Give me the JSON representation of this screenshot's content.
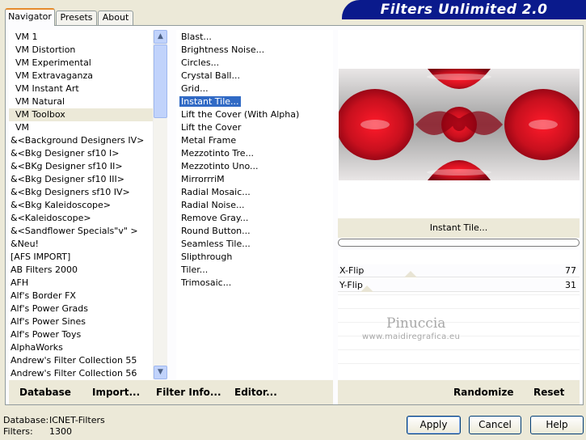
{
  "tabs": [
    {
      "label": "Navigator",
      "active": true
    },
    {
      "label": "Presets",
      "active": false
    },
    {
      "label": "About",
      "active": false
    }
  ],
  "banner_title": "Filters Unlimited 2.0",
  "categories": [
    "VM 1",
    "VM Distortion",
    "VM Experimental",
    "VM Extravaganza",
    "VM Instant Art",
    "VM Natural",
    "VM Toolbox",
    "VM",
    "&<Background Designers IV>",
    "&<Bkg Designer sf10 I>",
    "&<BKg Designer sf10 II>",
    "&<Bkg Designer sf10 III>",
    "&<Bkg Designers sf10 IV>",
    "&<Bkg Kaleidoscope>",
    "&<Kaleidoscope>",
    "&<Sandflower Specials\"v\" >",
    "&Neu!",
    "[AFS IMPORT]",
    "AB Filters 2000",
    "AFH",
    "Alf's Border FX",
    "Alf's Power Grads",
    "Alf's Power Sines",
    "Alf's Power Toys",
    "AlphaWorks",
    "Andrew's Filter Collection 55",
    "Andrew's Filter Collection 56"
  ],
  "selected_category": "VM Toolbox",
  "filters": [
    "Blast...",
    "Brightness Noise...",
    "Circles...",
    "Crystal Ball...",
    "Grid...",
    "Instant Tile...",
    "Lift the Cover (With Alpha)",
    "Lift the Cover",
    "Metal Frame",
    "Mezzotinto Tre...",
    "Mezzotinto Uno...",
    "MirrorrriM",
    "Radial Mosaic...",
    "Radial Noise...",
    "Remove Gray...",
    "Round Button...",
    "Seamless Tile...",
    "Slipthrough",
    "Tiler...",
    "Trimosaic..."
  ],
  "selected_filter": "Instant Tile...",
  "filter_name": "Instant Tile...",
  "params": [
    {
      "label": "X-Flip",
      "value": "77",
      "fraction": 0.3
    },
    {
      "label": "Y-Flip",
      "value": "31",
      "fraction": 0.12
    }
  ],
  "watermark": {
    "line1": "Pinuccia",
    "line2": "www.maidiregrafica.eu"
  },
  "toolbar": {
    "database": "Database",
    "import": "Import...",
    "filter_info": "Filter Info...",
    "editor": "Editor...",
    "randomize": "Randomize",
    "reset": "Reset"
  },
  "status": {
    "database_label": "Database:",
    "database_value": "ICNET-Filters",
    "filters_label": "Filters:",
    "filters_value": "1300"
  },
  "buttons": {
    "apply": "Apply",
    "cancel": "Cancel",
    "help": "Help"
  },
  "colors": {
    "selection": "#316ac5",
    "banner": "#0a1a8c",
    "tab_accent": "#e68b2c"
  }
}
